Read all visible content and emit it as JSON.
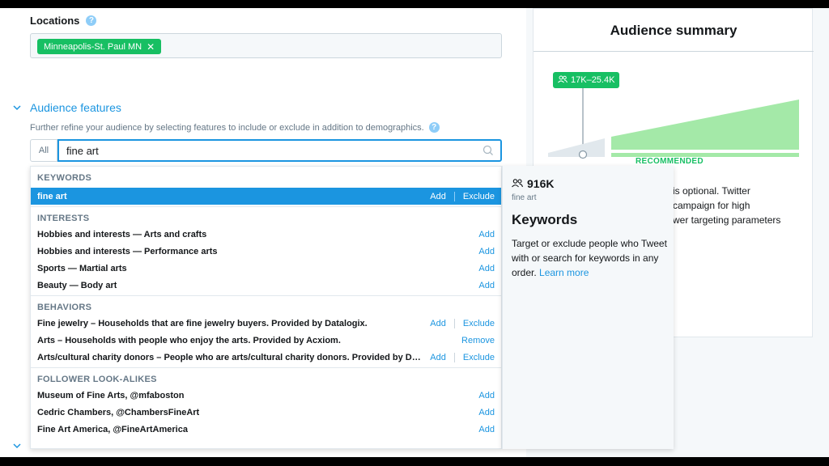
{
  "locations": {
    "title": "Locations",
    "help": "?",
    "chip": "Minneapolis-St. Paul MN",
    "chip_remove": "✕"
  },
  "audience_features": {
    "title": "Audience features",
    "description": "Further refine your audience by selecting features to include or exclude in addition to demographics.",
    "help": "?",
    "scope_button": "All",
    "search_value": "fine art"
  },
  "dropdown": {
    "keywords": {
      "heading": "KEYWORDS",
      "rows": [
        {
          "name": "fine art",
          "add": "Add",
          "exclude": "Exclude"
        }
      ]
    },
    "interests": {
      "heading": "INTERESTS",
      "rows": [
        {
          "name": "Hobbies and interests — Arts and crafts",
          "add": "Add"
        },
        {
          "name": "Hobbies and interests — Performance arts",
          "add": "Add"
        },
        {
          "name": "Sports — Martial arts",
          "add": "Add"
        },
        {
          "name": "Beauty — Body art",
          "add": "Add"
        }
      ]
    },
    "behaviors": {
      "heading": "BEHAVIORS",
      "rows": [
        {
          "name": "Fine jewelry – Households that are fine jewelry buyers. Provided by Datalogix.",
          "add": "Add",
          "exclude": "Exclude"
        },
        {
          "name": "Arts – Households with people who enjoy the arts. Provided by Acxiom.",
          "remove": "Remove"
        },
        {
          "name": "Arts/cultural charity donors – People who are arts/cultural charity donors. Provided by Data…",
          "add": "Add",
          "exclude": "Exclude"
        }
      ]
    },
    "followers": {
      "heading": "FOLLOWER LOOK-ALIKES",
      "rows": [
        {
          "name": "Museum of Fine Arts, @mfaboston",
          "add": "Add"
        },
        {
          "name": "Cedric Chambers, @ChambersFineArt",
          "add": "Add"
        },
        {
          "name": "Fine Art America, @FineArtAmerica",
          "add": "Add"
        }
      ]
    }
  },
  "tooltip": {
    "count": "916K",
    "keyword": "fine art",
    "title": "Keywords",
    "body": "Target or exclude people who Tweet with or search for keywords in any order.",
    "link": "Learn more"
  },
  "summary": {
    "title": "Audience summary",
    "range": "17K–25.4K",
    "recommended": "RECOMMENDED",
    "text_lines": [
      "is optional. Twitter",
      "campaign for high",
      "wer targeting parameters"
    ]
  },
  "colors": {
    "accent": "#1b95e0",
    "success": "#17bf63",
    "chart_fill": "#a4e9a8"
  }
}
